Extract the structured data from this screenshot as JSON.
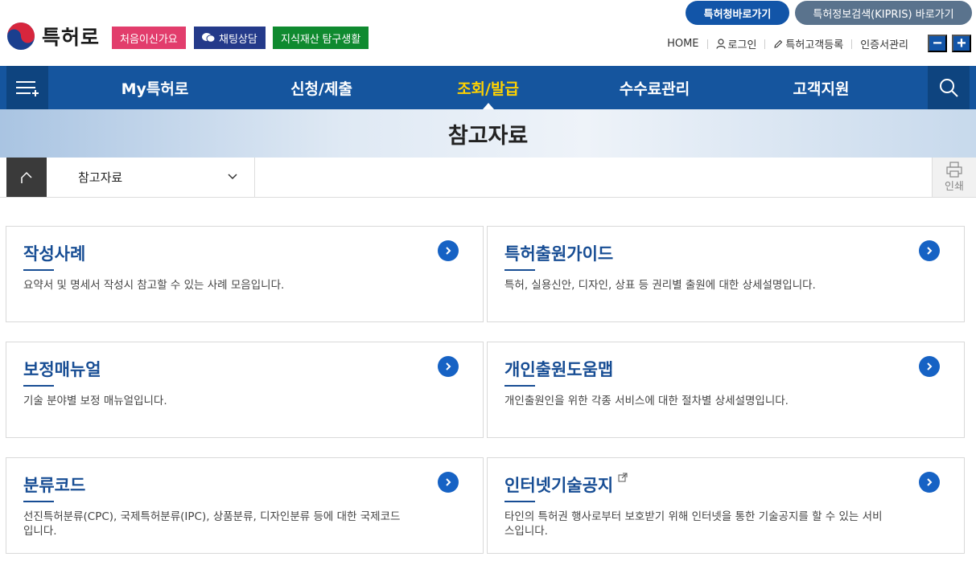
{
  "header": {
    "logo_text": "특허로",
    "quick_buttons": {
      "first_visit": "처음이신가요",
      "chat": "채팅상담",
      "ip_life": "지식재산 탐구생활"
    },
    "top_links": {
      "kipo": "특허청바로가기",
      "kipris": "특허정보검색(KIPRIS) 바로가기"
    },
    "util": {
      "home": "HOME",
      "login": "로그인",
      "register": "특허고객등록",
      "cert": "인증서관리"
    },
    "zoom_out": "−",
    "zoom_in": "+"
  },
  "nav": {
    "items": [
      "My특허로",
      "신청/제출",
      "조회/발급",
      "수수료관리",
      "고객지원"
    ],
    "active_index": 2
  },
  "banner": {
    "title": "참고자료"
  },
  "breadcrumb": {
    "current": "참고자료",
    "print_label": "인쇄"
  },
  "cards": [
    {
      "title": "작성사례",
      "desc": "요약서 및 명세서 작성시 참고할 수 있는 사례 모음입니다."
    },
    {
      "title": "특허출원가이드",
      "desc": "특허, 실용신안, 디자인, 상표 등 권리별 출원에 대한 상세설명입니다."
    },
    {
      "title": "보정매뉴얼",
      "desc": "기술 분야별 보정 매뉴얼입니다."
    },
    {
      "title": "개인출원도움맵",
      "desc": "개인출원인을 위한 각종 서비스에 대한 절차별 상세설명입니다."
    },
    {
      "title": "분류코드",
      "desc": "선진특허분류(CPC), 국제특허분류(IPC), 상품분류, 디자인분류 등에 대한 국제코드입니다."
    },
    {
      "title": "인터넷기술공지",
      "desc": "타인의 특허권 행사로부터 보호받기 위해 인터넷을 통한 기술공지를 할 수 있는 서비스입니다.",
      "external": true
    }
  ],
  "colors": {
    "nav": "#15559e",
    "nav_dark": "#0e447f",
    "active": "#ffd200",
    "card_title": "#174d94",
    "go_button": "#1662c4"
  }
}
